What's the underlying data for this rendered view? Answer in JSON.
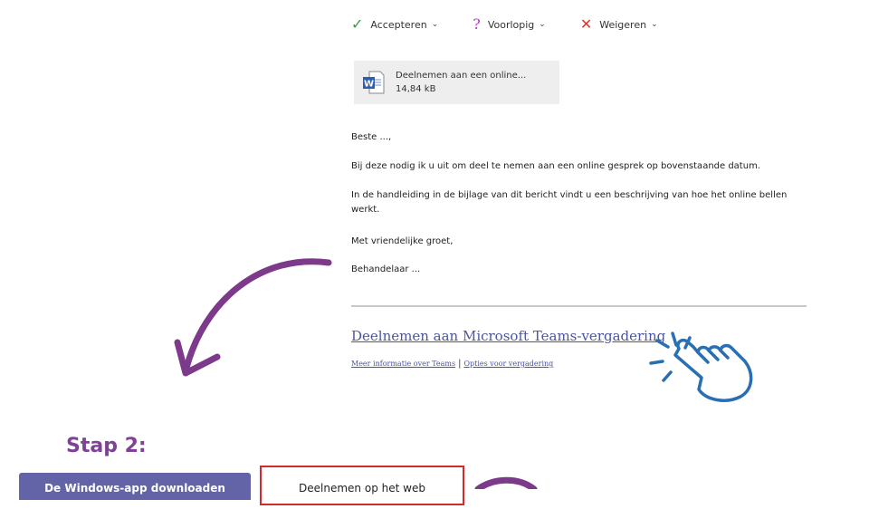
{
  "rsvp": {
    "accept_label": "Accepteren",
    "tentative_label": "Voorlopig",
    "decline_label": "Weigeren"
  },
  "attachment": {
    "name": "Deelnemen aan een online...",
    "size": "14,84 kB",
    "icon": "word-document-icon"
  },
  "email": {
    "greeting": "Beste ...,",
    "para1": "Bij deze nodig ik u uit om deel te nemen aan een online gesprek op bovenstaande datum.",
    "para2": "In de handleiding in de bijlage van dit bericht vindt u een beschrijving van hoe het online bellen werkt.",
    "closing": "Met vriendelijke groet,",
    "signature": "Behandelaar ..."
  },
  "teams": {
    "join_link": "Deelnemen aan Microsoft Teams-vergadering",
    "more_info": "Meer informatie over Teams",
    "separator": "|",
    "options": "Opties voor vergadering"
  },
  "step": {
    "label": "Stap 2:",
    "download_button": "De Windows-app downloaden",
    "web_button": "Deelnemen op het web"
  },
  "colors": {
    "arrow": "#7e3a8a",
    "hand": "#2a6fb3",
    "highlight_border": "#d42a2a",
    "teams_purple": "#6264a7",
    "link": "#4b54a3"
  }
}
